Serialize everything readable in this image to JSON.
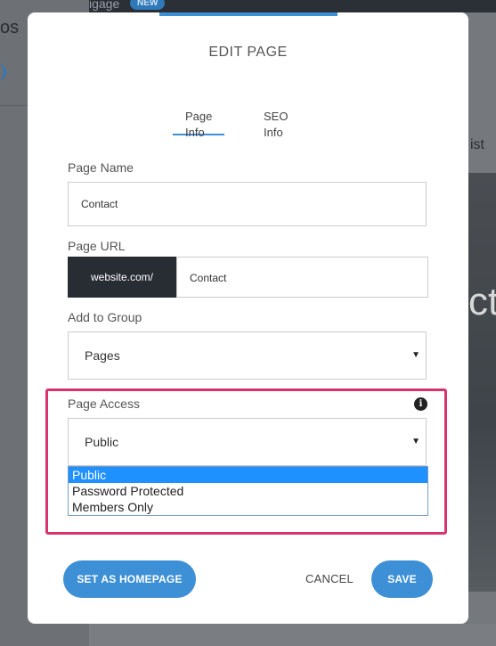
{
  "background": {
    "left_fragment": "os",
    "top_fragment": "igage",
    "top_badge": "NEW",
    "right_fragment": "ist",
    "right_big_fragment": "ct"
  },
  "modal": {
    "title": "EDIT PAGE",
    "tabs": [
      {
        "label": "Page Info",
        "active": true
      },
      {
        "label": "SEO Info",
        "active": false
      }
    ],
    "page_name": {
      "label": "Page Name",
      "value": "Contact"
    },
    "page_url": {
      "label": "Page URL",
      "prefix": "website.com/",
      "value": "Contact"
    },
    "group": {
      "label": "Add to Group",
      "selected": "Pages"
    },
    "access": {
      "label": "Page Access",
      "selected": "Public",
      "options": [
        "Public",
        "Password Protected",
        "Members Only"
      ],
      "highlighted_option": "Public"
    },
    "buttons": {
      "homepage": "SET AS HOMEPAGE",
      "cancel": "CANCEL",
      "save": "SAVE"
    }
  },
  "colors": {
    "accent": "#3d8fd6",
    "highlight_border": "#d8336f",
    "url_prefix_bg": "#282c33",
    "selected_option": "#1e90ff"
  }
}
